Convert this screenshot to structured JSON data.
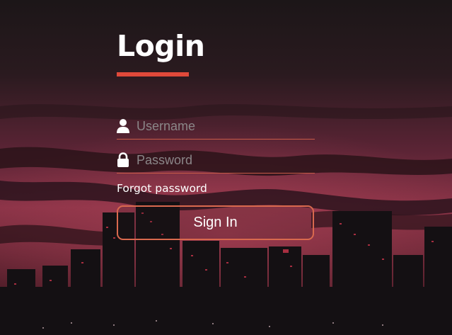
{
  "login": {
    "title": "Login",
    "username_placeholder": "Username",
    "password_placeholder": "Password",
    "forgot_password": "Forgot password",
    "sign_in": "Sign In"
  },
  "icons": {
    "username": "user-icon",
    "password": "lock-icon"
  },
  "colors": {
    "accent": "#e0493a",
    "field_underline": "#c95b48",
    "button_border": "#d9694e",
    "text": "#ffffff",
    "placeholder": "#8b8688"
  }
}
